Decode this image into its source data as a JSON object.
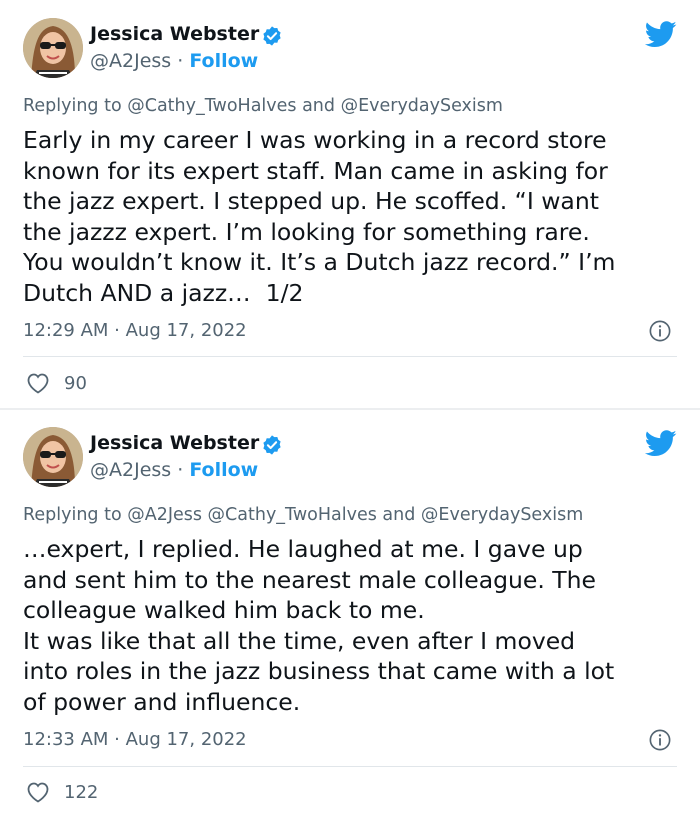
{
  "colors": {
    "accent": "#1d9bf0",
    "text": "#0f1419",
    "muted": "#536471"
  },
  "tweets": [
    {
      "author": {
        "name": "Jessica Webster",
        "handle": "@A2Jess",
        "separator": "·",
        "follow_label": "Follow",
        "avatar_icon": "user-photo-avatar",
        "verified_icon": "verified-badge-icon"
      },
      "reply_to": "Replying to @Cathy_TwoHalves and @EverydaySexism",
      "text": "Early in my career I was working in a record store\nknown for its expert staff. Man came in asking for\nthe jazz expert. I stepped up. He scoffed. “I want\nthe jazzz expert. I’m looking for something rare.\nYou wouldn’t know it. It’s a Dutch jazz record.” I’m\nDutch AND a jazz…  1/2",
      "timestamp": "12:29 AM · Aug 17, 2022",
      "likes": "90"
    },
    {
      "author": {
        "name": "Jessica Webster",
        "handle": "@A2Jess",
        "separator": "·",
        "follow_label": "Follow",
        "avatar_icon": "user-photo-avatar",
        "verified_icon": "verified-badge-icon"
      },
      "reply_to": "Replying to @A2Jess @Cathy_TwoHalves and @EverydaySexism",
      "text": "…expert, I replied. He laughed at me. I gave up\nand sent him to the nearest male colleague. The\ncolleague walked him back to me.\nIt was like that all the time, even after I moved\ninto roles in the jazz business that came with a lot\nof power and influence.",
      "timestamp": "12:33 AM · Aug 17, 2022",
      "likes": "122"
    }
  ]
}
